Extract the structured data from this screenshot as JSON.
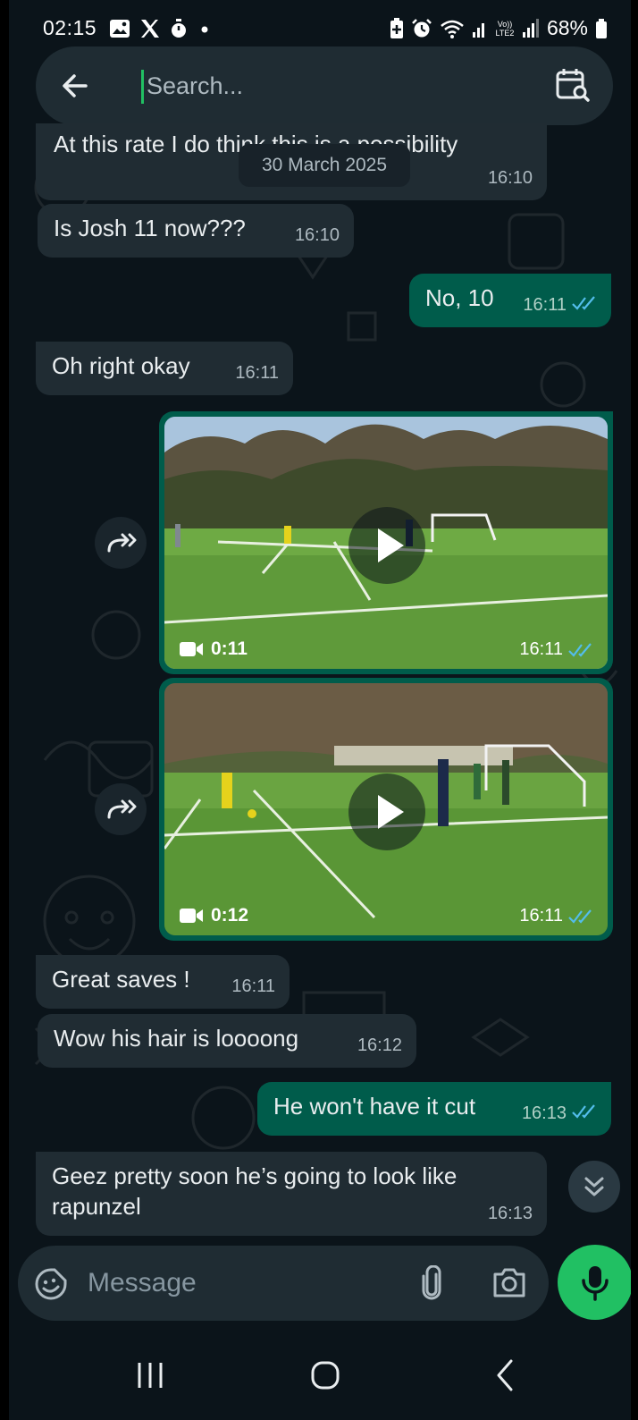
{
  "status_bar": {
    "time": "02:15",
    "battery": "68%",
    "icons_left": [
      "gallery-icon",
      "x-logo-icon",
      "stopwatch-icon",
      "dot-icon"
    ],
    "icons_right": [
      "battery-saver-icon",
      "alarm-icon",
      "wifi-icon",
      "signal-icon",
      "volte-icon",
      "signal-icon",
      "battery-icon"
    ],
    "volte_label": "Vo)) LTE2"
  },
  "search": {
    "placeholder": "Search...",
    "value": "",
    "back_icon": "arrow-left-icon",
    "calendar_icon": "calendar-search-icon"
  },
  "date_chip": "30 March 2025",
  "messages": [
    {
      "id": "m1",
      "dir": "in",
      "text": "At this rate I do think this is a possibility",
      "time": "16:10"
    },
    {
      "id": "m2",
      "dir": "in",
      "text": "Is Josh 11 now???",
      "time": "16:10"
    },
    {
      "id": "m3",
      "dir": "out",
      "text": "No, 10",
      "time": "16:11",
      "status": "read"
    },
    {
      "id": "m4",
      "dir": "in",
      "text": "Oh right okay",
      "time": "16:11"
    },
    {
      "id": "m5",
      "dir": "out",
      "type": "video",
      "duration": "0:11",
      "time": "16:11",
      "status": "read"
    },
    {
      "id": "m6",
      "dir": "out",
      "type": "video",
      "duration": "0:12",
      "time": "16:11",
      "status": "read"
    },
    {
      "id": "m7",
      "dir": "in",
      "text": "Great saves !",
      "time": "16:11"
    },
    {
      "id": "m8",
      "dir": "in",
      "text": "Wow his hair is loooong",
      "time": "16:12"
    },
    {
      "id": "m9",
      "dir": "out",
      "text": "He won't have it cut",
      "time": "16:13",
      "status": "read"
    },
    {
      "id": "m10",
      "dir": "in",
      "text": "Geez pretty soon he’s going to look like rapunzel",
      "time": "16:13"
    }
  ],
  "composer": {
    "placeholder": "Message",
    "emoji_icon": "sticker-icon",
    "attach_icon": "paperclip-icon",
    "camera_icon": "camera-icon",
    "mic_icon": "mic-icon"
  },
  "colors": {
    "background": "#0b141a",
    "incoming": "#202c33",
    "outgoing": "#005c4b",
    "accent": "#21c063",
    "read_ticks": "#53bdeb"
  }
}
